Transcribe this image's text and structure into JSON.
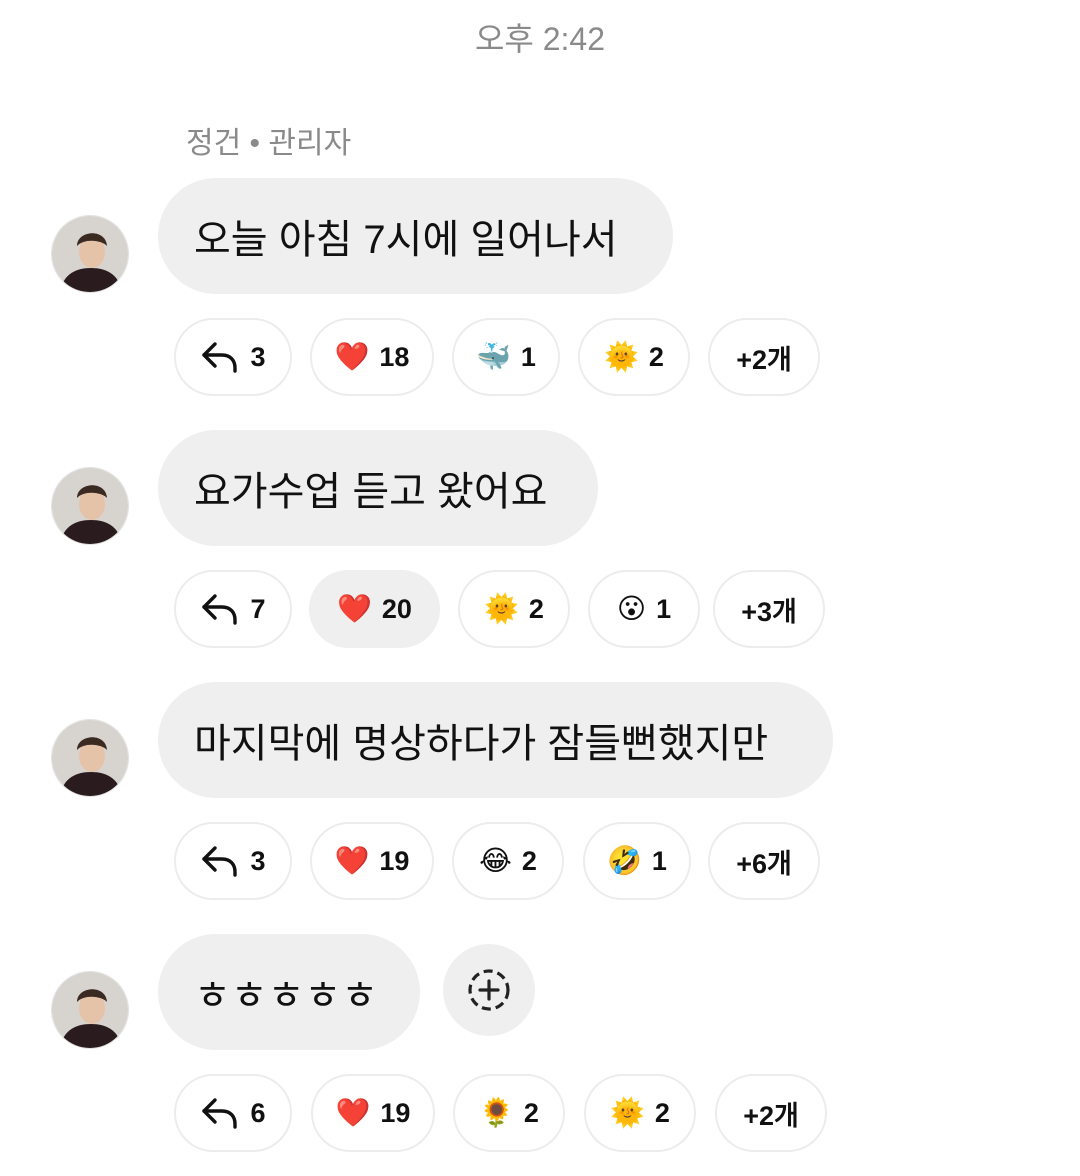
{
  "header": {
    "time": "오후 2:42"
  },
  "sender": {
    "name": "정건",
    "separator": "•",
    "role": "관리자"
  },
  "messages": [
    {
      "text": "오늘 아침 7시에 일어나서",
      "reactions": [
        {
          "icon": "reply-icon",
          "count": "3"
        },
        {
          "emoji": "❤️",
          "icon": "heart-icon",
          "count": "18"
        },
        {
          "emoji": "🐳",
          "icon": "whale-icon",
          "count": "1"
        },
        {
          "emoji": "🌞",
          "icon": "sun-face-icon",
          "count": "2"
        },
        {
          "label": "+2개"
        }
      ]
    },
    {
      "text": "요가수업 듣고 왔어요",
      "reactions": [
        {
          "icon": "reply-icon",
          "count": "7"
        },
        {
          "emoji": "❤️",
          "icon": "heart-icon",
          "count": "20",
          "active": true
        },
        {
          "emoji": "🌞",
          "icon": "sun-face-icon",
          "count": "2"
        },
        {
          "emoji": "😮",
          "icon": "surprised-face-icon",
          "count": "1"
        },
        {
          "label": "+3개"
        }
      ]
    },
    {
      "text": "마지막에 명상하다가 잠들뻔했지만",
      "reactions": [
        {
          "icon": "reply-icon",
          "count": "3"
        },
        {
          "emoji": "❤️",
          "icon": "heart-icon",
          "count": "19"
        },
        {
          "emoji": "😂",
          "icon": "tears-of-joy-icon",
          "count": "2"
        },
        {
          "emoji": "🤣",
          "icon": "rofl-icon",
          "count": "1"
        },
        {
          "label": "+6개"
        }
      ]
    },
    {
      "text": "ㅎㅎㅎㅎㅎ",
      "reactions": [
        {
          "icon": "reply-icon",
          "count": "6"
        },
        {
          "emoji": "❤️",
          "icon": "heart-icon",
          "count": "19"
        },
        {
          "emoji": "🌻",
          "icon": "sunflower-icon",
          "count": "2"
        },
        {
          "emoji": "🌞",
          "icon": "sun-face-icon",
          "count": "2"
        },
        {
          "label": "+2개"
        }
      ]
    }
  ],
  "colors": {
    "bubble": "#efefef",
    "meta_text": "#8a8a8a",
    "chip_border": "#ececec",
    "heart": "#f0386b"
  }
}
